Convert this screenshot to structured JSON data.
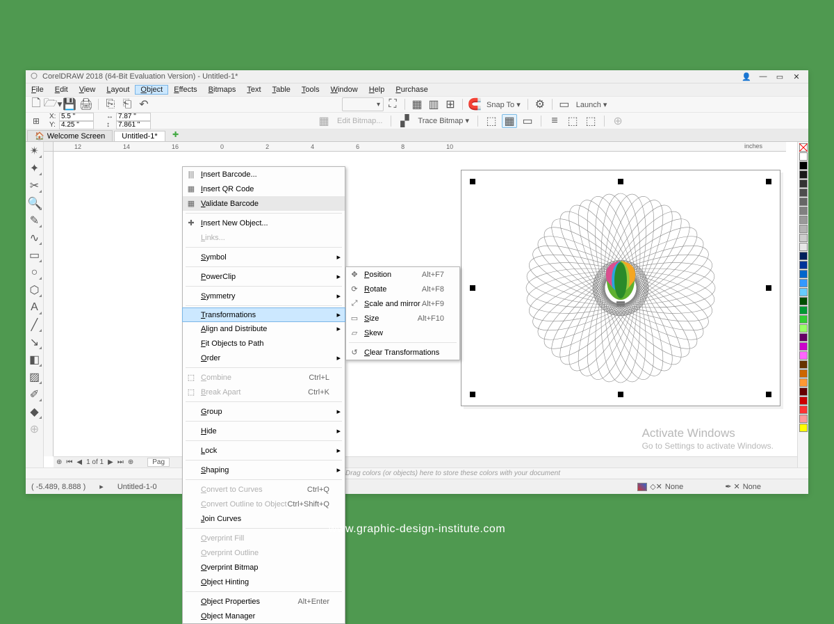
{
  "titlebar": {
    "text": "CorelDRAW 2018 (64-Bit Evaluation Version) - Untitled-1*"
  },
  "menubar": [
    "File",
    "Edit",
    "View",
    "Layout",
    "Object",
    "Effects",
    "Bitmaps",
    "Text",
    "Table",
    "Tools",
    "Window",
    "Help",
    "Purchase"
  ],
  "menubar_active_index": 4,
  "toolbar": {
    "snap": "Snap To",
    "launch": "Launch"
  },
  "propbar": {
    "x": "5.5 \"",
    "y": "4.25 \"",
    "w": "7.87 \"",
    "h": "7.861 \"",
    "edit_bitmap": "Edit Bitmap...",
    "trace": "Trace Bitmap"
  },
  "tabs": {
    "welcome": "Welcome Screen",
    "untitled": "Untitled-1*"
  },
  "ruler": {
    "marks": [
      "12",
      "14",
      "16",
      "0",
      "2",
      "4",
      "6",
      "8",
      "10"
    ],
    "units": "inches"
  },
  "docnav": {
    "text": "1 of 1",
    "page": "Pag"
  },
  "colordrop": {
    "hint": "Drag colors (or objects) here to store these colors with your document"
  },
  "status": {
    "coord": "( -5.489, 8.888 )",
    "doc": "Untitled-1-0",
    "fill_label": "None",
    "outline_label": "None"
  },
  "object_menu": [
    {
      "label": "Insert Barcode...",
      "icon": "|||"
    },
    {
      "label": "Insert QR Code",
      "icon": "▦"
    },
    {
      "label": "Validate Barcode",
      "icon": "▦",
      "hover": true
    },
    {
      "type": "sep"
    },
    {
      "label": "Insert New Object...",
      "icon": "✚"
    },
    {
      "label": "Links...",
      "disabled": true
    },
    {
      "type": "sep"
    },
    {
      "label": "Symbol",
      "sub": true
    },
    {
      "type": "sep"
    },
    {
      "label": "PowerClip",
      "sub": true
    },
    {
      "type": "sep"
    },
    {
      "label": "Symmetry",
      "sub": true
    },
    {
      "type": "sep"
    },
    {
      "label": "Transformations",
      "sub": true,
      "hl": true
    },
    {
      "label": "Align and Distribute",
      "sub": true
    },
    {
      "label": "Fit Objects to Path"
    },
    {
      "label": "Order",
      "sub": true
    },
    {
      "type": "sep"
    },
    {
      "label": "Combine",
      "shortcut": "Ctrl+L",
      "disabled": true,
      "icon": "⬚"
    },
    {
      "label": "Break Apart",
      "shortcut": "Ctrl+K",
      "disabled": true,
      "icon": "⬚"
    },
    {
      "type": "sep"
    },
    {
      "label": "Group",
      "sub": true
    },
    {
      "type": "sep"
    },
    {
      "label": "Hide",
      "sub": true
    },
    {
      "type": "sep"
    },
    {
      "label": "Lock",
      "sub": true
    },
    {
      "type": "sep"
    },
    {
      "label": "Shaping",
      "sub": true
    },
    {
      "type": "sep"
    },
    {
      "label": "Convert to Curves",
      "shortcut": "Ctrl+Q",
      "disabled": true
    },
    {
      "label": "Convert Outline to Object",
      "shortcut": "Ctrl+Shift+Q",
      "disabled": true
    },
    {
      "label": "Join Curves"
    },
    {
      "type": "sep"
    },
    {
      "label": "Overprint Fill",
      "disabled": true
    },
    {
      "label": "Overprint Outline",
      "disabled": true
    },
    {
      "label": "Overprint Bitmap"
    },
    {
      "label": "Object Hinting"
    },
    {
      "type": "sep"
    },
    {
      "label": "Object Properties",
      "shortcut": "Alt+Enter"
    },
    {
      "label": "Object Manager"
    }
  ],
  "transform_submenu": [
    {
      "label": "Position",
      "shortcut": "Alt+F7",
      "icon": "✥"
    },
    {
      "label": "Rotate",
      "shortcut": "Alt+F8",
      "icon": "⟳"
    },
    {
      "label": "Scale and mirror",
      "shortcut": "Alt+F9",
      "icon": "⤢"
    },
    {
      "label": "Size",
      "shortcut": "Alt+F10",
      "icon": "▭"
    },
    {
      "label": "Skew",
      "icon": "▱"
    },
    {
      "type": "sep"
    },
    {
      "label": "Clear Transformations",
      "icon": "↺"
    }
  ],
  "colors": [
    "#ffffff",
    "#000000",
    "#1a1a1a",
    "#333333",
    "#4d4d4d",
    "#666666",
    "#808080",
    "#999999",
    "#b3b3b3",
    "#cccccc",
    "#e6e6e6",
    "#001f5b",
    "#003399",
    "#0066cc",
    "#3399ff",
    "#66ccff",
    "#004d00",
    "#009933",
    "#33cc33",
    "#99ff66",
    "#660066",
    "#cc00cc",
    "#ff66ff",
    "#663300",
    "#cc6600",
    "#ff9933",
    "#660000",
    "#cc0000",
    "#ff3333",
    "#ff9999",
    "#ffff00"
  ],
  "watermark": {
    "title": "Activate Windows",
    "subtitle": "Go to Settings to activate Windows."
  },
  "footer": "www.graphic-design-institute.com"
}
